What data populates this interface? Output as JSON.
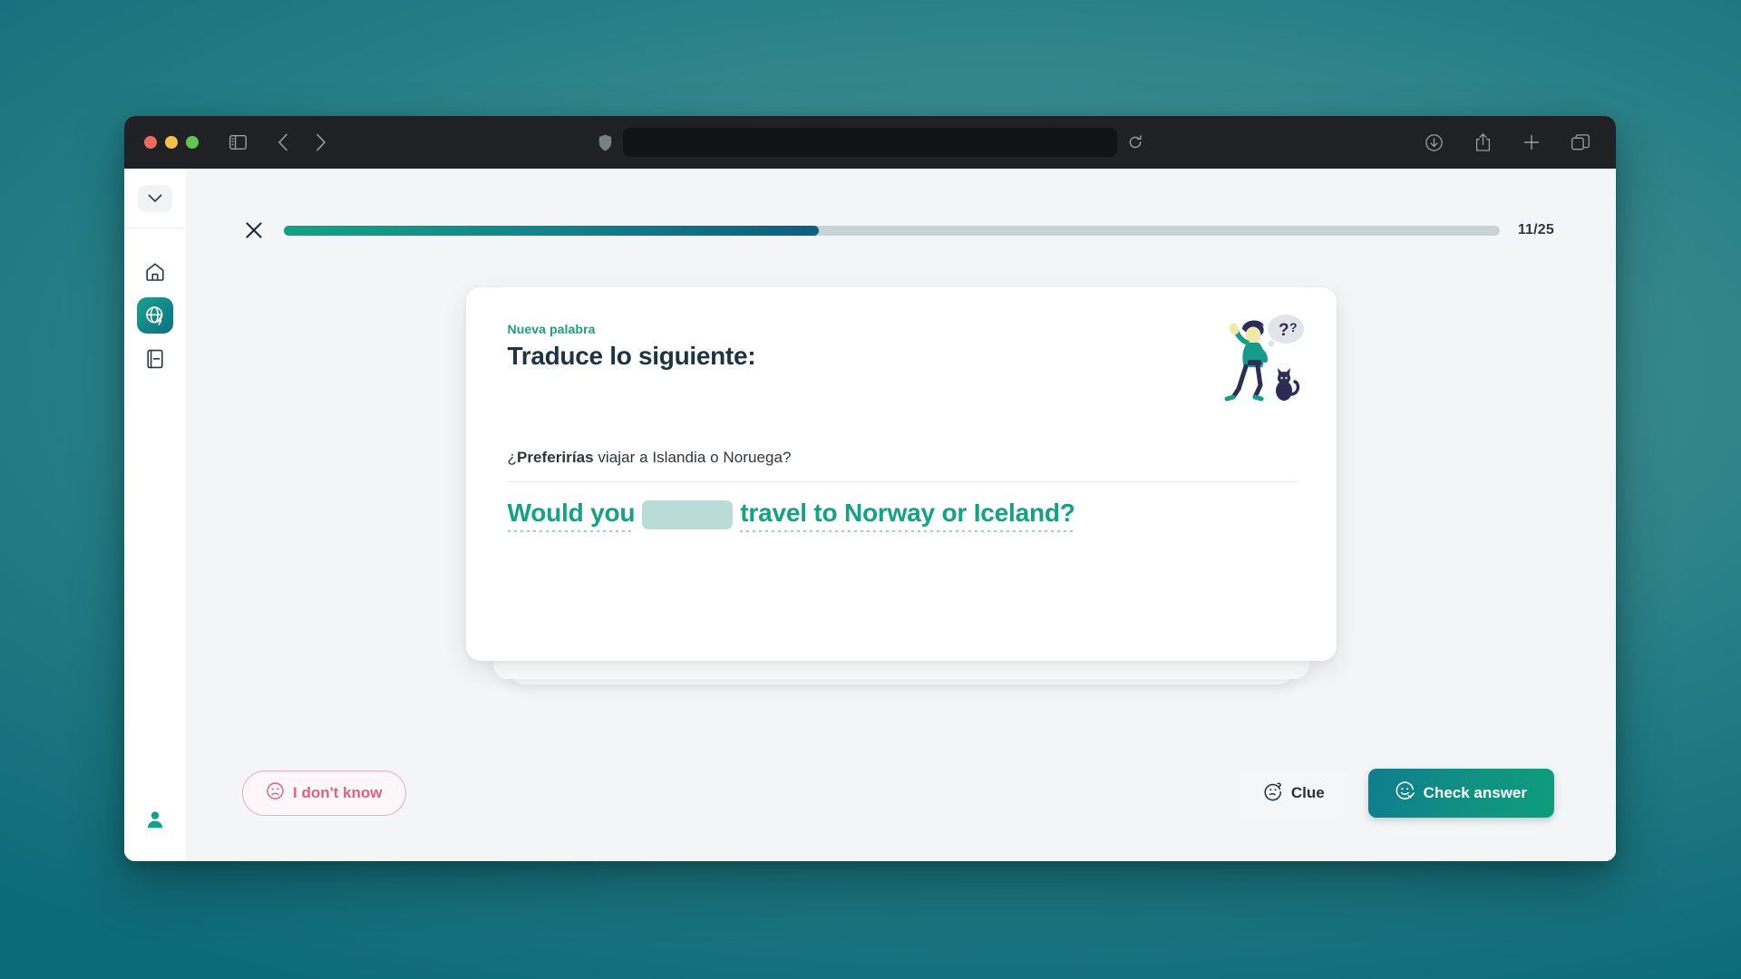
{
  "browser": {
    "traffic_lights": [
      "close",
      "minimize",
      "maximize"
    ],
    "sidebar_toggle_icon": "sidebar-toggle-icon",
    "back_icon": "chevron-left-icon",
    "forward_icon": "chevron-right-icon",
    "shield_icon": "shield-icon",
    "address_value": "",
    "address_placeholder": "",
    "reload_icon": "reload-icon",
    "right_icons": [
      "download-icon",
      "share-icon",
      "new-tab-icon",
      "tab-overview-icon"
    ]
  },
  "sidebar": {
    "collapse_icon": "chevron-down-icon",
    "items": [
      {
        "name": "home",
        "icon": "home-icon",
        "active": false
      },
      {
        "name": "practice",
        "icon": "globe-lightning-icon",
        "active": true
      },
      {
        "name": "library",
        "icon": "book-icon",
        "active": false
      }
    ],
    "profile_icon": "person-icon"
  },
  "lesson": {
    "close_label": "×",
    "progress_current": 11,
    "progress_total": 25,
    "progress_text": "11/25",
    "progress_percent": 44
  },
  "card": {
    "kicker": "Nueva palabra",
    "title": "Traduce lo siguiente:",
    "illustration": "person-walking-with-cat-thinking-illustration",
    "prompt_prefix": "¿",
    "prompt_bold": "Preferirías",
    "prompt_rest": " viajar a Islandia o Noruega?",
    "answer_before": "Would you",
    "answer_blank_value": "",
    "answer_after": "travel to Norway or Iceland?"
  },
  "actions": {
    "dont_know_label": "I don't know",
    "dont_know_icon": "sad-face-icon",
    "clue_label": "Clue",
    "clue_icon": "thinking-face-icon",
    "check_label": "Check answer",
    "check_icon": "smiley-check-icon"
  },
  "colors": {
    "brand_teal": "#16a085",
    "brand_deep": "#0c5f80",
    "danger_pink": "#e2607f",
    "card_bg": "#ffffff",
    "page_bg": "#f4f5f6",
    "desktop_gradient_from": "#0d6a78",
    "desktop_gradient_to": "#5ba2a0"
  }
}
